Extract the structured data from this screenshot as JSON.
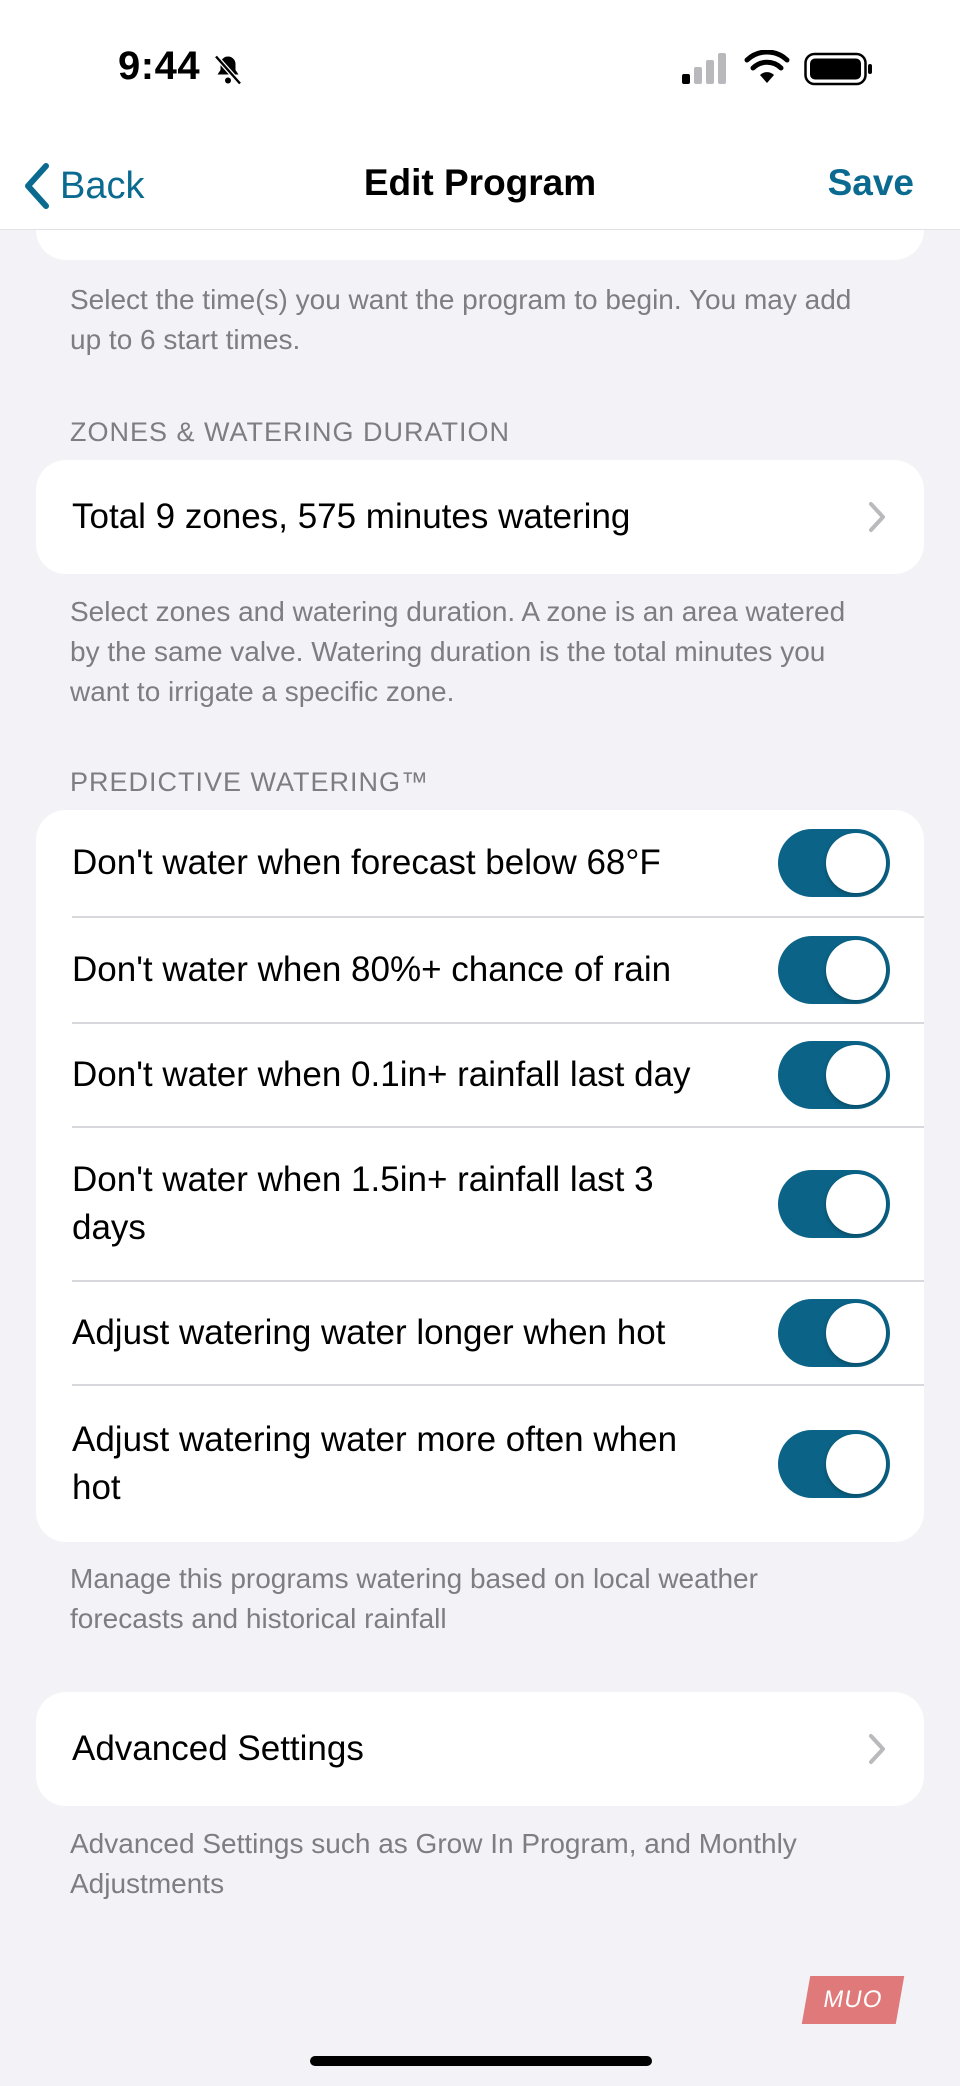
{
  "status_bar": {
    "time": "9:44",
    "bell_icon": "bell-slash-icon",
    "signal_icon": "cellular-signal-icon",
    "wifi_icon": "wifi-icon",
    "battery_icon": "battery-icon"
  },
  "nav": {
    "back_label": "Back",
    "title": "Edit Program",
    "save_label": "Save"
  },
  "start_times": {
    "footnote": "Select the time(s) you want the program to begin. You may add up to 6 start times."
  },
  "zones": {
    "header": "ZONES & WATERING DURATION",
    "summary": "Total 9 zones, 575 minutes watering",
    "footnote": "Select zones and watering duration. A zone is an area watered by the same valve. Watering duration is the total minutes you want to irrigate a specific zone."
  },
  "predictive": {
    "header": "PREDICTIVE WATERING™",
    "items": [
      {
        "label": "Don't water when forecast below 68°F",
        "on": true
      },
      {
        "label": "Don't water when 80%+ chance of rain",
        "on": true
      },
      {
        "label": "Don't water when 0.1in+ rainfall last day",
        "on": true
      },
      {
        "label": "Don't water when 1.5in+ rainfall last 3 days",
        "on": true
      },
      {
        "label": "Adjust watering water longer when hot",
        "on": true
      },
      {
        "label": "Adjust watering water more often when hot",
        "on": true
      }
    ],
    "footnote": "Manage this programs watering based on local weather forecasts and historical rainfall"
  },
  "advanced": {
    "label": "Advanced Settings",
    "footnote": "Advanced Settings such as Grow In Program, and Monthly Adjustments"
  },
  "colors": {
    "accent": "#0a6a8f",
    "toggle_on": "#0b6387",
    "background": "#f2f2f7"
  },
  "watermark": "MUO"
}
